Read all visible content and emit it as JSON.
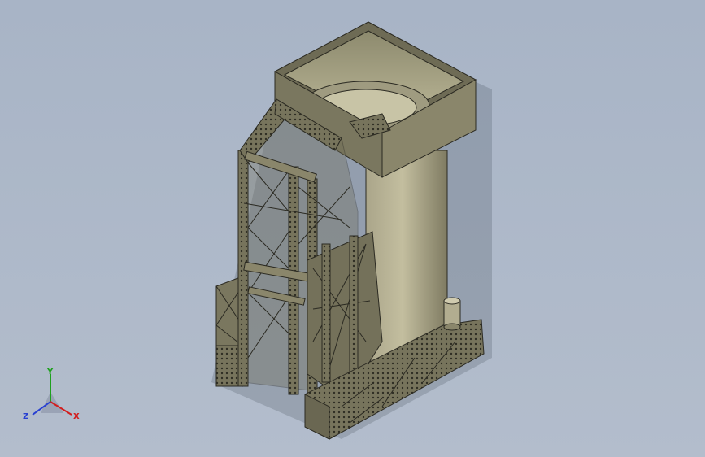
{
  "viewport": {
    "background_top": "#a8b4c6",
    "background_bottom": "#b3bdcc",
    "model_color": "#7e7b64",
    "edge_color": "#2b2a22"
  },
  "axis_triad": {
    "x_label": "X",
    "y_label": "Y",
    "z_label": "Z",
    "x_color": "#d21e1e",
    "y_color": "#1ea01e",
    "z_color": "#2840d2"
  }
}
